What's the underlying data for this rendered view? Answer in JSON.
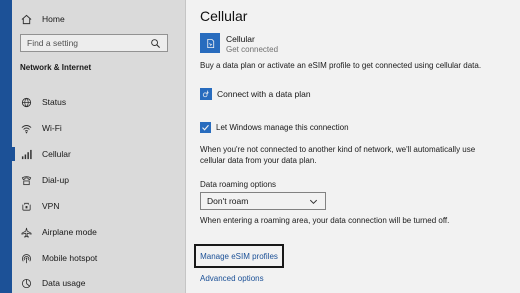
{
  "sidebar": {
    "home_label": "Home",
    "search_placeholder": "Find a setting",
    "section_title": "Network & Internet",
    "items": [
      {
        "label": "Status",
        "icon": "globe-icon"
      },
      {
        "label": "Wi-Fi",
        "icon": "wifi-icon"
      },
      {
        "label": "Cellular",
        "icon": "cellular-signal-icon",
        "active": true
      },
      {
        "label": "Dial-up",
        "icon": "phone-icon"
      },
      {
        "label": "VPN",
        "icon": "vpn-icon"
      },
      {
        "label": "Airplane mode",
        "icon": "airplane-icon"
      },
      {
        "label": "Mobile hotspot",
        "icon": "hotspot-icon"
      },
      {
        "label": "Data usage",
        "icon": "data-usage-icon"
      }
    ]
  },
  "main": {
    "title": "Cellular",
    "cellular_name": "Cellular",
    "cellular_status": "Get connected",
    "buy_text": "Buy a data plan or activate an eSIM profile to get connected using cellular data.",
    "connect_label": "Connect with a data plan",
    "manage_label": "Let Windows manage this connection",
    "manage_checked": true,
    "manage_desc": "When you're not connected to another kind of network, we'll automatically use cellular data from your data plan.",
    "roaming_label": "Data roaming options",
    "roaming_value": "Don't roam",
    "roaming_desc": "When entering a roaming area, your data connection will be turned off.",
    "esim_link": "Manage eSIM profiles",
    "advanced_link": "Advanced options"
  },
  "colors": {
    "accent": "#2b72c9",
    "link": "#1e56a0",
    "sidebar_bg": "#e6e6e6"
  }
}
